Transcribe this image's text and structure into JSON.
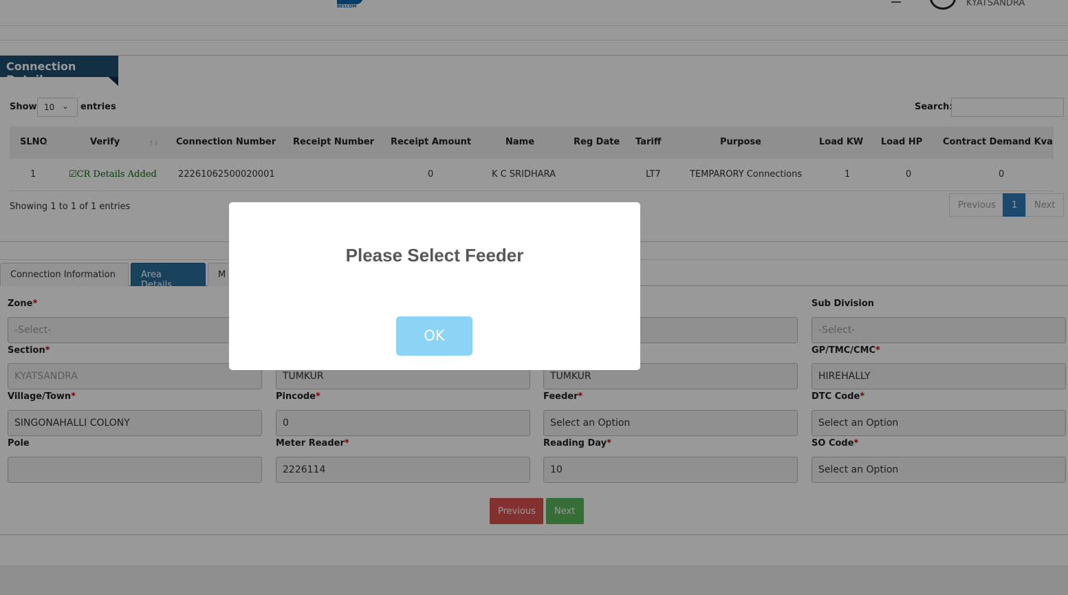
{
  "header": {
    "logo_text": "BESCOM",
    "user_name": "KYATSANDRA"
  },
  "section_title": "Connection Details",
  "table_controls": {
    "show": "Show",
    "page_size": "10",
    "entries": "entries",
    "search_label": "Search:",
    "search_value": ""
  },
  "table": {
    "columns": [
      "SLNO",
      "Verify",
      "Connection Number",
      "Receipt Number",
      "Receipt Amount",
      "Name",
      "Reg Date",
      "Tariff",
      "Purpose",
      "Load KW",
      "Load HP",
      "Contract Demand Kva"
    ],
    "rows": [
      {
        "slno": "1",
        "verify": "CR Details Added",
        "connection_number": "22261062500020001",
        "receipt_number": "",
        "receipt_amount": "0",
        "name": "K C SRIDHARA",
        "reg_date": "",
        "tariff": "LT7",
        "purpose": "TEMPARORY Connections",
        "load_kw": "1",
        "load_hp": "0",
        "contract_demand": "0"
      }
    ]
  },
  "table_info": "Showing 1 to 1 of 1 entries",
  "pagination": {
    "previous": "Previous",
    "current": "1",
    "next": "Next"
  },
  "tabs": [
    "Connection Information",
    "Area Details",
    "M"
  ],
  "form": {
    "zone": {
      "label": "Zone",
      "value": "-Select-"
    },
    "sub_division": {
      "label": "Sub Division",
      "value": "-Select-"
    },
    "section": {
      "label": "Section",
      "value": "KYATSANDRA"
    },
    "col2_row2": {
      "value": "TUMKUR"
    },
    "col3_row2": {
      "value": "TUMKUR"
    },
    "gp": {
      "label": "GP/TMC/CMC",
      "value": "HIREHALLY"
    },
    "village": {
      "label": "Village/Town",
      "value": "SINGONAHALLI COLONY"
    },
    "pincode": {
      "label": "Pincode",
      "value": "0"
    },
    "feeder": {
      "label": "Feeder",
      "value": "Select an Option"
    },
    "dtc": {
      "label": "DTC Code",
      "value": "Select an Option"
    },
    "pole": {
      "label": "Pole",
      "value": ""
    },
    "meter_reader": {
      "label": "Meter Reader",
      "value": "2226114"
    },
    "reading_day": {
      "label": "Reading Day",
      "value": "10"
    },
    "so_code": {
      "label": "SO Code",
      "value": "Select an Option"
    },
    "required_mark": "*"
  },
  "buttons": {
    "previous": "Previous",
    "next": "Next"
  },
  "modal": {
    "title": "Please Select Feeder",
    "ok": "OK"
  },
  "colors": {
    "accent": "#1d4d6e",
    "danger": "#d9534f",
    "success": "#5cb85c",
    "ok": "#8cd4f5"
  }
}
